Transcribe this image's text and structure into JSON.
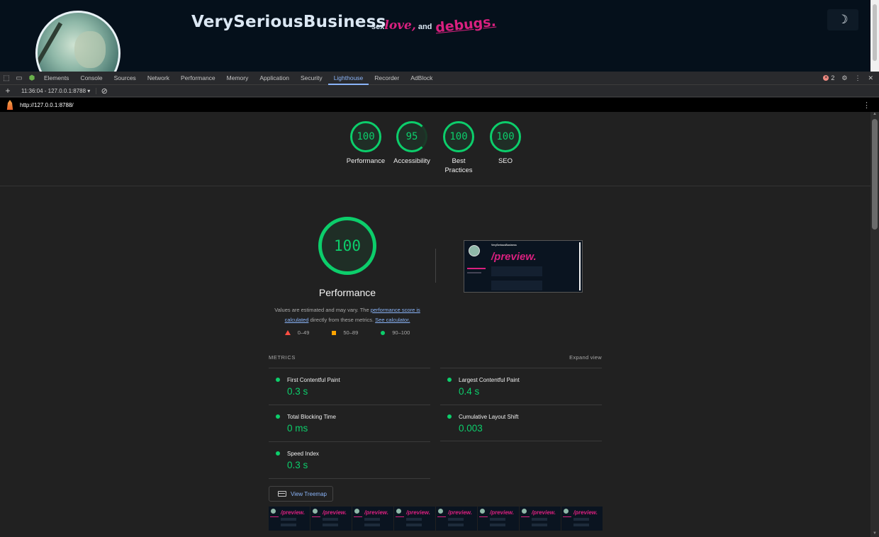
{
  "site": {
    "brand": "VerySeriousBusiness",
    "tag_prefix": "sex",
    "tag_love": "love,",
    "tag_and": "and",
    "tag_debugs": "debugs.",
    "theme_toggle_icon": "moon-icon"
  },
  "devtools": {
    "tabs": [
      "Elements",
      "Console",
      "Sources",
      "Network",
      "Performance",
      "Memory",
      "Application",
      "Security",
      "Lighthouse",
      "Recorder",
      "AdBlock"
    ],
    "active_tab": "Lighthouse",
    "error_count": "2",
    "report_selector": "11:36:04 - 127.0.0.1:8788 ▾",
    "url": "http://127.0.0.1:8788/"
  },
  "summary": {
    "gauges": [
      {
        "score": "100",
        "label": "Performance"
      },
      {
        "score": "95",
        "label": "Accessibility"
      },
      {
        "score": "100",
        "label": "Best Practices"
      },
      {
        "score": "100",
        "label": "SEO"
      }
    ]
  },
  "performance": {
    "score": "100",
    "title": "Performance",
    "desc_start": "Values are estimated and may vary. The ",
    "desc_link1": "performance score is calculated",
    "desc_mid": " directly from these metrics. ",
    "desc_link2": "See calculator.",
    "legend": {
      "fail": "0–49",
      "average": "50–89",
      "pass": "90–100"
    },
    "screenshot_text": "/preview.",
    "screenshot_brand": "VerySeriousBusiness"
  },
  "metrics": {
    "header": "METRICS",
    "expand_label": "Expand view",
    "items": [
      {
        "name": "First Contentful Paint",
        "value": "0.3 s"
      },
      {
        "name": "Largest Contentful Paint",
        "value": "0.4 s"
      },
      {
        "name": "Total Blocking Time",
        "value": "0 ms"
      },
      {
        "name": "Cumulative Layout Shift",
        "value": "0.003"
      },
      {
        "name": "Speed Index",
        "value": "0.3 s"
      }
    ],
    "treemap_label": "View Treemap"
  },
  "filmstrip": {
    "frame_text": "/preview."
  },
  "colors": {
    "pass": "#0cce6b",
    "average": "#ffa400",
    "fail": "#ff4e42",
    "accent_link": "#8ab4f8",
    "brand_pink": "#d9207f"
  }
}
